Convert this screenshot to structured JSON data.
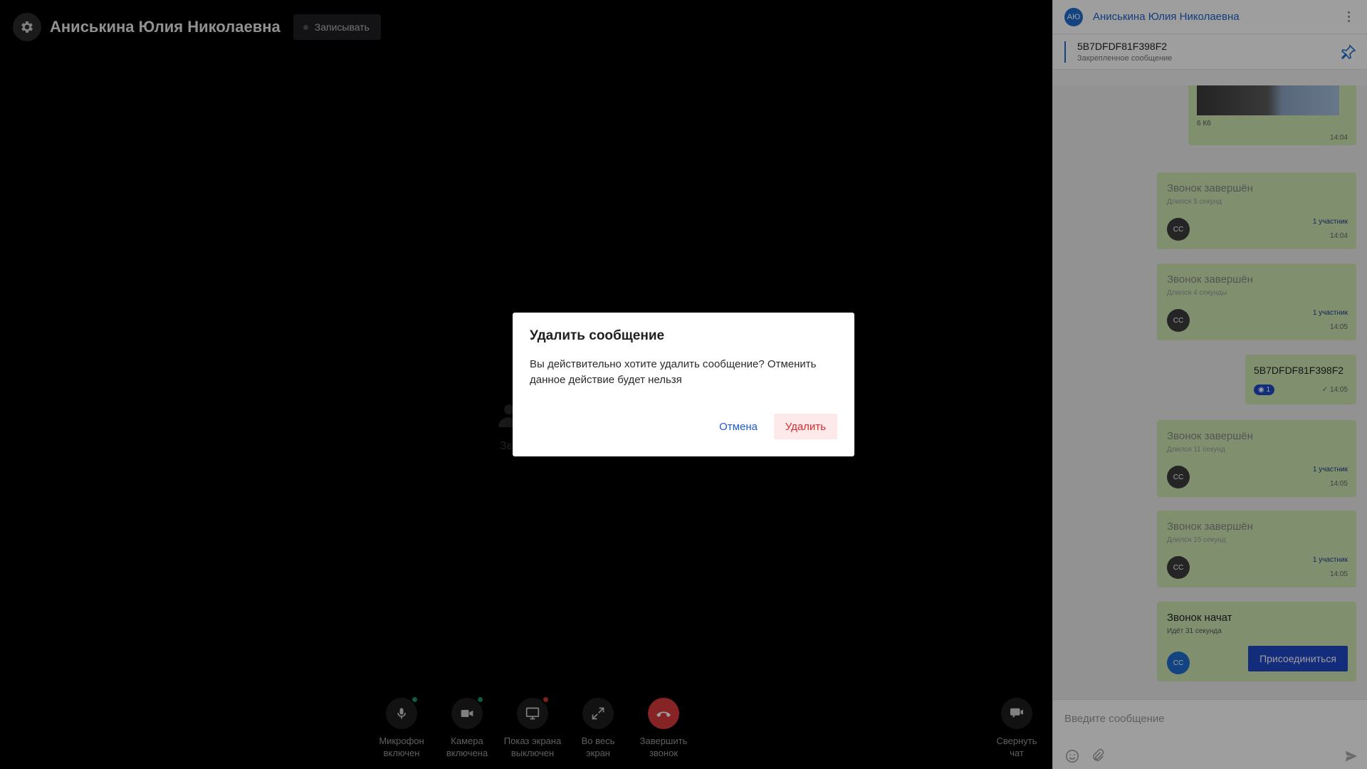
{
  "call": {
    "title": "Аниськина Юлия Николаевна",
    "record_label": "Записывать",
    "placeholder_text": "Зв"
  },
  "controls": [
    {
      "label_line1": "Микрофон",
      "label_line2": "включен",
      "icon": "microphone-icon",
      "badge": "#1f8f6b"
    },
    {
      "label_line1": "Камера",
      "label_line2": "включена",
      "icon": "camera-icon",
      "badge": "#1f8f6b"
    },
    {
      "label_line1": "Показ экрана",
      "label_line2": "выключен",
      "icon": "monitor-icon",
      "badge": "#c0392b"
    },
    {
      "label_line1": "Во весь",
      "label_line2": "экран",
      "icon": "fullscreen-icon",
      "badge": ""
    },
    {
      "label_line1": "Завершить",
      "label_line2": "звонок",
      "icon": "hang-up-icon",
      "badge": ""
    }
  ],
  "chat_toggle": {
    "label_line1": "Свернуть",
    "label_line2": "чат",
    "icon": "chat-icon"
  },
  "chat": {
    "avatar": "АЮ",
    "name": "Аниськина Юлия Николаевна",
    "pinned": {
      "title": "5B7DFDF81F398F2",
      "subtitle": "Закрепленное сообщение"
    },
    "messages": {
      "image_msg": {
        "size": "6 Кб",
        "time": "14:04"
      },
      "call1": {
        "title": "Звонок завершён",
        "sub": "Длился 5 секунд",
        "avatar": "СС",
        "participants": "1 участник",
        "time": "14:04"
      },
      "call2": {
        "title": "Звонок завершён",
        "sub": "Длился 4 секунды",
        "avatar": "СС",
        "participants": "1 участник",
        "time": "14:05"
      },
      "text_msg": {
        "text": "5B7DFDF81F398F2",
        "reaction": "1",
        "time": "14:05"
      },
      "call3": {
        "title": "Звонок завершён",
        "sub": "Длился 11 секунд",
        "avatar": "СС",
        "participants": "1 участник",
        "time": "14:05"
      },
      "call4": {
        "title": "Звонок завершён",
        "sub": "Длился 15 секунд",
        "avatar": "СС",
        "participants": "1 участник",
        "time": "14:05"
      },
      "call5": {
        "title": "Звонок начат",
        "sub": "Идёт 31 секунда",
        "avatar": "СС",
        "join_label": "Присоединиться"
      }
    },
    "composer_placeholder": "Введите сообщение"
  },
  "dialog": {
    "title": "Удалить сообщение",
    "text": "Вы действительно хотите удалить сообщение? Отменить данное действие будет нельзя",
    "cancel_label": "Отмена",
    "delete_label": "Удалить"
  }
}
